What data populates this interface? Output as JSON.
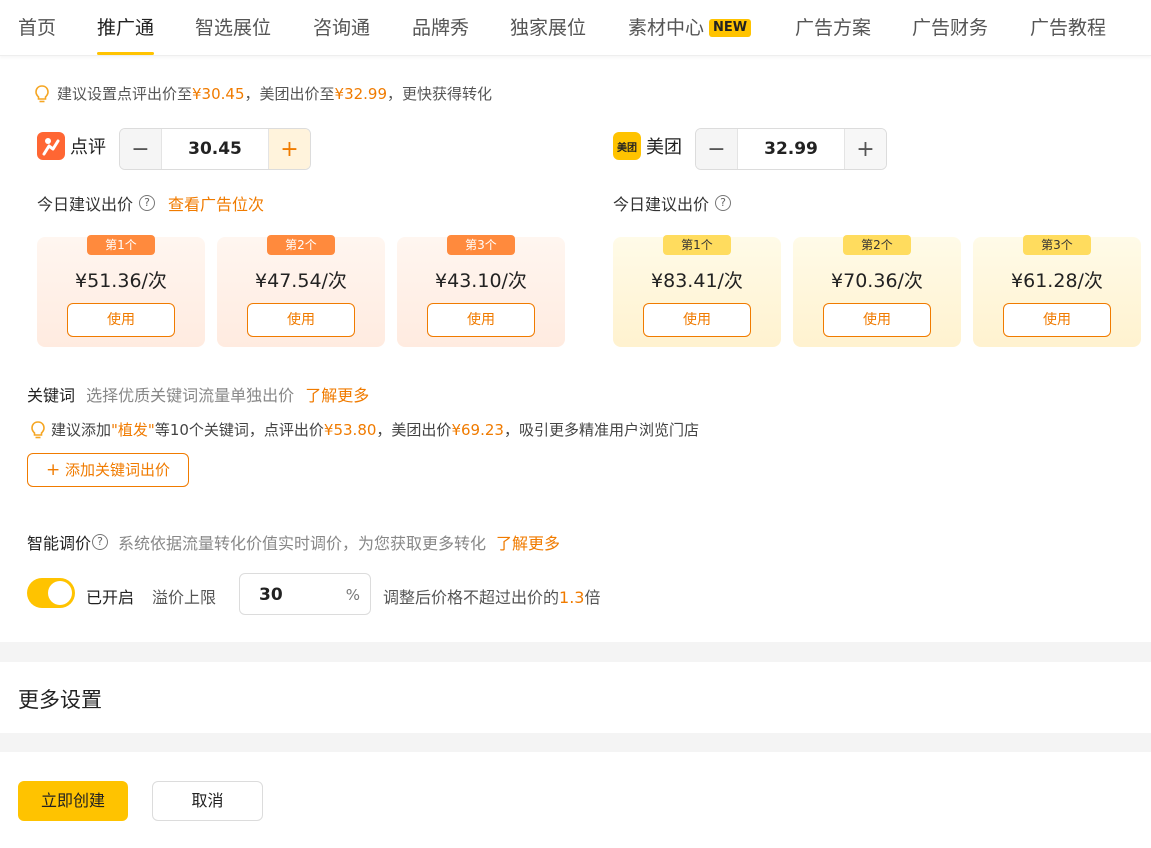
{
  "nav": {
    "items": [
      "首页",
      "推广通",
      "智选展位",
      "咨询通",
      "品牌秀",
      "独家展位",
      "素材中心",
      "广告方案",
      "广告财务",
      "广告教程"
    ],
    "new_badge": "NEW",
    "active_index": 1
  },
  "bid_tip": {
    "prefix": "建议设置点评出价至",
    "dp_price": "¥30.45",
    "middle": "，美团出价至",
    "mt_price": "¥32.99",
    "suffix": "，更快获得转化"
  },
  "dianping": {
    "name": "点评",
    "bid": "30.45",
    "suggest_title": "今日建议出价",
    "view_link": "查看广告位次",
    "ranks": [
      {
        "tag": "第1个",
        "price": "¥51.36/次",
        "use": "使用"
      },
      {
        "tag": "第2个",
        "price": "¥47.54/次",
        "use": "使用"
      },
      {
        "tag": "第3个",
        "price": "¥43.10/次",
        "use": "使用"
      }
    ]
  },
  "meituan": {
    "name": "美团",
    "logo_text": "美团",
    "bid": "32.99",
    "suggest_title": "今日建议出价",
    "ranks": [
      {
        "tag": "第1个",
        "price": "¥83.41/次",
        "use": "使用"
      },
      {
        "tag": "第2个",
        "price": "¥70.36/次",
        "use": "使用"
      },
      {
        "tag": "第3个",
        "price": "¥61.28/次",
        "use": "使用"
      }
    ]
  },
  "keywords": {
    "label": "关键词",
    "desc": "选择优质关键词流量单独出价",
    "learn_more": "了解更多",
    "tip_prefix": "建议添加",
    "tip_keyword": "\"植发\"",
    "tip_mid1": "等10个关键词，点评出价",
    "tip_dp": "¥53.80",
    "tip_mid2": "，美团出价",
    "tip_mt": "¥69.23",
    "tip_suffix": "，吸引更多精准用户浏览门店",
    "add_button": "添加关键词出价"
  },
  "smart": {
    "label": "智能调价",
    "desc": "系统依据流量转化价值实时调价，为您获取更多转化",
    "learn_more": "了解更多",
    "toggle_label": "已开启",
    "toggle_on": true,
    "cap_label": "溢价上限",
    "cap_value": "30",
    "cap_unit": "%",
    "note_prefix": "调整后价格不超过出价的",
    "note_value": "1.3",
    "note_suffix": "倍"
  },
  "more_settings": {
    "title": "更多设置"
  },
  "actions": {
    "create": "立即创建",
    "cancel": "取消"
  },
  "colors": {
    "accent": "#ffc300",
    "link": "#f07b00"
  }
}
